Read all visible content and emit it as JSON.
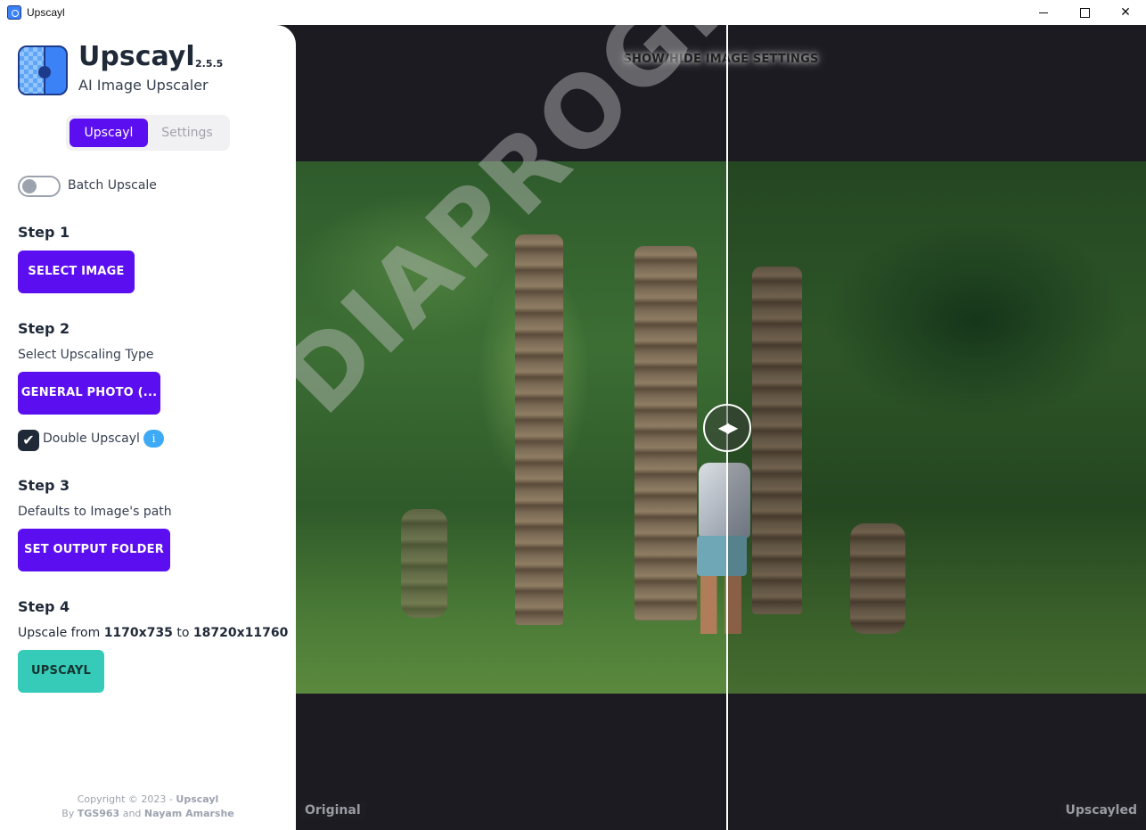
{
  "window": {
    "title": "Upscayl",
    "controls": {
      "minimize": "",
      "maximize": "",
      "close": "✕"
    }
  },
  "sidebar": {
    "app_name": "Upscayl",
    "version": "2.5.5",
    "subtitle": "AI Image Upscaler",
    "tabs": [
      {
        "label": "Upscayl",
        "active": true
      },
      {
        "label": "Settings",
        "active": false
      }
    ],
    "batch_toggle": {
      "label": "Batch Upscale",
      "on": false
    },
    "step1": {
      "title": "Step 1",
      "button": "SELECT IMAGE"
    },
    "step2": {
      "title": "Step 2",
      "hint": "Select Upscaling Type",
      "button": "GENERAL PHOTO (...",
      "double_upscayl": {
        "label": "Double Upscayl",
        "checked": true,
        "info": "i",
        "check": "✔"
      }
    },
    "step3": {
      "title": "Step 3",
      "hint": "Defaults to Image's path",
      "button": "SET OUTPUT FOLDER"
    },
    "step4": {
      "title": "Step 4",
      "upscale_prefix": "Upscale from",
      "from_size": "1170x735",
      "to_word": "to",
      "to_size": "18720x11760",
      "button": "UPSCAYL"
    },
    "footer": {
      "copyright": "Copyright © 2023 -",
      "brand": "Upscayl",
      "by": "By",
      "author1": "TGS963",
      "and": "and",
      "author2": "Nayam Amarshe"
    }
  },
  "viewer": {
    "settings_toggle": "SHOW/HIDE IMAGE SETTINGS",
    "watermark": "DIAPROG.in.ua",
    "slider_icon": "◀▶",
    "label_left": "Original",
    "label_right": "Upscayled"
  },
  "colors": {
    "accent": "#5b0ef0",
    "upscayl_button": "#36cbb9",
    "info": "#3eaaf5",
    "viewer_bg": "#1c1b22"
  }
}
